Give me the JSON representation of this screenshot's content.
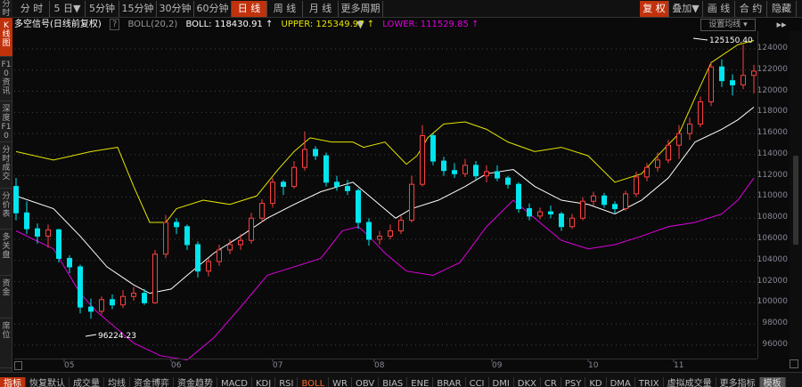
{
  "corner_label": "分时",
  "periods": [
    {
      "label": "分 时"
    },
    {
      "label": "5 日▼"
    },
    {
      "label": "5分钟"
    },
    {
      "label": "15分钟"
    },
    {
      "label": "30分钟"
    },
    {
      "label": "60分钟"
    },
    {
      "label": "日 线",
      "active": true
    },
    {
      "label": "周 线"
    },
    {
      "label": "月 线"
    },
    {
      "label": "更多周期▼"
    }
  ],
  "right_tools": [
    {
      "label": "复 权",
      "active": true
    },
    {
      "label": "叠加▼"
    },
    {
      "label": "画 线"
    },
    {
      "label": "合 约"
    },
    {
      "label": "隐藏▸▸"
    }
  ],
  "info": {
    "title": "多空信号(日线前复权)",
    "help": "?",
    "indicator": "BOLL(20,2)",
    "boll": "BOLL: 118430.91 ↑",
    "upper": "UPPER: 125349.97 ↑",
    "lower": "LOWER: 111529.85 ↑"
  },
  "set_ma": "设置均线 ▾",
  "sidebar": [
    "K线图",
    "F10资讯",
    "深度F10",
    "分时成交",
    "分价表",
    "多关盘",
    "资金",
    "席位"
  ],
  "colors": {
    "up": "#ff4040",
    "down": "#00e5ee",
    "mid": "#ffffff",
    "upper": "#e6e600",
    "lower": "#e000e0",
    "accent": "#c0320c"
  },
  "chart_data": {
    "type": "candlestick",
    "title": "BOLL(20,2)",
    "unit": "thousands",
    "ylim": [
      94.5,
      126
    ],
    "yticks": [
      124,
      122,
      120,
      118,
      116,
      114,
      112,
      110,
      108,
      106,
      104,
      102,
      100,
      98,
      96
    ],
    "ytick_labels": [
      "124000",
      "122000",
      "120000",
      "118000",
      "116000",
      "114000",
      "112000",
      "110000",
      "108000",
      "106000",
      "104000",
      "102000",
      "100000",
      "98000",
      "96000"
    ],
    "months": [
      {
        "day": 9,
        "label": "05"
      },
      {
        "day": 29,
        "label": "06"
      },
      {
        "day": 48,
        "label": "07"
      },
      {
        "day": 67,
        "label": "08"
      },
      {
        "day": 89,
        "label": "09"
      },
      {
        "day": 107,
        "label": "10"
      },
      {
        "day": 123,
        "label": "11"
      }
    ],
    "max_label": "125150.40",
    "min_label": "96224.23",
    "candles_ohlc_every2days": [
      [
        111.0,
        111.8,
        107.8,
        108.5
      ],
      [
        108.5,
        109.6,
        106.5,
        107.0
      ],
      [
        107.0,
        107.5,
        105.6,
        106.3
      ],
      [
        106.3,
        107.4,
        105.2,
        106.9
      ],
      [
        106.9,
        107.0,
        103.8,
        104.2
      ],
      [
        104.2,
        104.5,
        102.8,
        103.4
      ],
      [
        103.4,
        103.6,
        99.0,
        99.6
      ],
      [
        99.6,
        100.4,
        98.5,
        99.2
      ],
      [
        99.2,
        100.6,
        98.9,
        100.3
      ],
      [
        100.3,
        100.8,
        99.4,
        99.8
      ],
      [
        99.8,
        101.2,
        99.5,
        100.6
      ],
      [
        100.6,
        101.5,
        100.2,
        100.9
      ],
      [
        100.9,
        101.3,
        99.8,
        100.0
      ],
      [
        100.0,
        105.0,
        99.9,
        104.6
      ],
      [
        104.6,
        108.3,
        104.2,
        107.6
      ],
      [
        107.6,
        108.0,
        106.5,
        107.2
      ],
      [
        107.2,
        107.4,
        105.0,
        105.5
      ],
      [
        105.5,
        105.8,
        102.4,
        103.0
      ],
      [
        103.0,
        104.2,
        102.5,
        103.9
      ],
      [
        103.9,
        105.5,
        103.5,
        105.0
      ],
      [
        105.0,
        106.0,
        104.6,
        105.5
      ],
      [
        105.5,
        106.5,
        105.0,
        105.9
      ],
      [
        105.9,
        108.5,
        105.6,
        108.0
      ],
      [
        108.0,
        109.8,
        107.6,
        109.4
      ],
      [
        109.4,
        111.8,
        109.0,
        111.4
      ],
      [
        111.4,
        111.6,
        110.2,
        111.0
      ],
      [
        111.0,
        113.4,
        110.8,
        112.8
      ],
      [
        112.8,
        116.2,
        112.5,
        114.5
      ],
      [
        114.5,
        114.8,
        113.5,
        113.9
      ],
      [
        113.9,
        114.2,
        111.0,
        111.4
      ],
      [
        111.4,
        112.0,
        110.6,
        111.0
      ],
      [
        111.0,
        111.6,
        110.2,
        110.6
      ],
      [
        110.6,
        110.8,
        107.0,
        107.6
      ],
      [
        107.6,
        108.0,
        105.4,
        106.0
      ],
      [
        106.0,
        106.8,
        105.5,
        106.3
      ],
      [
        106.3,
        107.4,
        106.0,
        106.8
      ],
      [
        106.8,
        108.2,
        106.5,
        107.8
      ],
      [
        107.8,
        112.0,
        107.6,
        111.2
      ],
      [
        111.2,
        116.8,
        111.0,
        115.8
      ],
      [
        115.8,
        116.0,
        113.0,
        113.4
      ],
      [
        113.4,
        113.8,
        112.0,
        112.5
      ],
      [
        112.5,
        113.2,
        111.8,
        112.2
      ],
      [
        112.2,
        113.6,
        111.9,
        113.0
      ],
      [
        113.0,
        113.4,
        111.6,
        112.0
      ],
      [
        112.0,
        113.0,
        111.4,
        112.4
      ],
      [
        112.4,
        113.0,
        111.5,
        111.8
      ],
      [
        111.8,
        112.0,
        110.8,
        111.2
      ],
      [
        111.2,
        111.4,
        108.5,
        108.9
      ],
      [
        108.9,
        109.4,
        107.8,
        108.2
      ],
      [
        108.2,
        109.0,
        107.9,
        108.6
      ],
      [
        108.6,
        109.2,
        108.0,
        108.4
      ],
      [
        108.4,
        108.6,
        106.8,
        107.2
      ],
      [
        107.2,
        108.4,
        107.0,
        108.0
      ],
      [
        108.0,
        110.0,
        107.8,
        109.6
      ],
      [
        109.6,
        110.5,
        109.2,
        110.1
      ],
      [
        110.1,
        110.4,
        109.0,
        109.3
      ],
      [
        109.3,
        109.6,
        108.4,
        108.9
      ],
      [
        108.9,
        110.6,
        108.7,
        110.3
      ],
      [
        110.3,
        112.4,
        110.0,
        111.9
      ],
      [
        111.9,
        113.2,
        111.5,
        112.8
      ],
      [
        112.8,
        114.2,
        112.4,
        113.5
      ],
      [
        113.5,
        115.4,
        113.2,
        114.9
      ],
      [
        114.9,
        116.8,
        113.6,
        116.0
      ],
      [
        116.0,
        117.5,
        115.4,
        116.9
      ],
      [
        116.9,
        119.5,
        116.6,
        119.0
      ],
      [
        119.0,
        122.8,
        118.6,
        122.3
      ],
      [
        122.3,
        123.0,
        120.4,
        121.0
      ],
      [
        121.0,
        121.6,
        119.6,
        120.6
      ],
      [
        120.6,
        124.4,
        120.2,
        121.5
      ],
      [
        121.5,
        122.5,
        119.8,
        121.9
      ]
    ],
    "upper": [
      [
        0,
        114.3
      ],
      [
        7,
        113.5
      ],
      [
        14,
        114.3
      ],
      [
        19,
        114.7
      ],
      [
        22,
        111.0
      ],
      [
        25,
        107.6
      ],
      [
        28,
        107.6
      ],
      [
        30,
        108.9
      ],
      [
        35,
        109.7
      ],
      [
        40,
        109.3
      ],
      [
        45,
        110.1
      ],
      [
        49,
        112.6
      ],
      [
        52,
        114.3
      ],
      [
        55,
        115.6
      ],
      [
        59,
        115.2
      ],
      [
        63,
        115.2
      ],
      [
        65,
        114.7
      ],
      [
        69,
        115.2
      ],
      [
        73,
        113.1
      ],
      [
        75,
        113.9
      ],
      [
        77,
        115.6
      ],
      [
        80,
        116.9
      ],
      [
        84,
        117.1
      ],
      [
        88,
        116.4
      ],
      [
        92,
        115.2
      ],
      [
        97,
        114.3
      ],
      [
        102,
        114.7
      ],
      [
        107,
        113.9
      ],
      [
        112,
        111.4
      ],
      [
        117,
        112.2
      ],
      [
        120,
        113.9
      ],
      [
        124,
        116.0
      ],
      [
        127,
        119.4
      ],
      [
        130,
        122.7
      ],
      [
        135,
        124.4
      ],
      [
        138,
        124.8
      ]
    ],
    "mid": [
      [
        0,
        110.1
      ],
      [
        7,
        108.9
      ],
      [
        12,
        106.3
      ],
      [
        17,
        103.4
      ],
      [
        22,
        101.7
      ],
      [
        25,
        100.9
      ],
      [
        29,
        101.3
      ],
      [
        32,
        102.6
      ],
      [
        37,
        104.7
      ],
      [
        42,
        106.3
      ],
      [
        47,
        108.0
      ],
      [
        52,
        109.3
      ],
      [
        57,
        110.5
      ],
      [
        63,
        111.4
      ],
      [
        67,
        109.7
      ],
      [
        71,
        108.0
      ],
      [
        74,
        108.9
      ],
      [
        79,
        109.7
      ],
      [
        84,
        111.0
      ],
      [
        88,
        112.2
      ],
      [
        93,
        112.6
      ],
      [
        97,
        111.0
      ],
      [
        102,
        109.7
      ],
      [
        107,
        109.3
      ],
      [
        112,
        108.4
      ],
      [
        117,
        109.7
      ],
      [
        122,
        111.8
      ],
      [
        127,
        115.2
      ],
      [
        132,
        116.4
      ],
      [
        135,
        117.3
      ],
      [
        138,
        118.5
      ]
    ],
    "lower": [
      [
        0,
        106.8
      ],
      [
        7,
        105.1
      ],
      [
        12,
        100.9
      ],
      [
        15,
        99.2
      ],
      [
        22,
        96.2
      ],
      [
        27,
        95.0
      ],
      [
        32,
        94.6
      ],
      [
        37,
        96.7
      ],
      [
        42,
        99.6
      ],
      [
        47,
        102.6
      ],
      [
        52,
        103.4
      ],
      [
        57,
        104.2
      ],
      [
        61,
        106.8
      ],
      [
        64,
        107.2
      ],
      [
        66,
        106.3
      ],
      [
        69,
        104.7
      ],
      [
        73,
        103.0
      ],
      [
        78,
        102.6
      ],
      [
        83,
        103.8
      ],
      [
        88,
        107.2
      ],
      [
        93,
        109.7
      ],
      [
        97,
        108.0
      ],
      [
        102,
        105.9
      ],
      [
        107,
        105.1
      ],
      [
        112,
        105.5
      ],
      [
        117,
        106.3
      ],
      [
        122,
        107.2
      ],
      [
        127,
        107.6
      ],
      [
        132,
        108.4
      ],
      [
        135,
        109.7
      ],
      [
        138,
        111.8
      ]
    ]
  },
  "bottom_tabs": [
    {
      "label": "指标",
      "cls": "active"
    },
    {
      "label": "恢复默认"
    },
    {
      "label": "成交量"
    },
    {
      "label": "均线"
    },
    {
      "label": "资金博弈"
    },
    {
      "label": "资金趋势"
    },
    {
      "label": "MACD"
    },
    {
      "label": "KDJ"
    },
    {
      "label": "RSI"
    },
    {
      "label": "BOLL",
      "cls": "orange"
    },
    {
      "label": "WR"
    },
    {
      "label": "OBV"
    },
    {
      "label": "BIAS"
    },
    {
      "label": "ENE"
    },
    {
      "label": "BRAR"
    },
    {
      "label": "CCI"
    },
    {
      "label": "DMI"
    },
    {
      "label": "DKX"
    },
    {
      "label": "CR"
    },
    {
      "label": "PSY"
    },
    {
      "label": "KD"
    },
    {
      "label": "DMA"
    },
    {
      "label": "TRIX"
    },
    {
      "label": "虚拟成交量"
    },
    {
      "label": "更多指标"
    },
    {
      "label": "模板",
      "cls": "grey"
    }
  ]
}
